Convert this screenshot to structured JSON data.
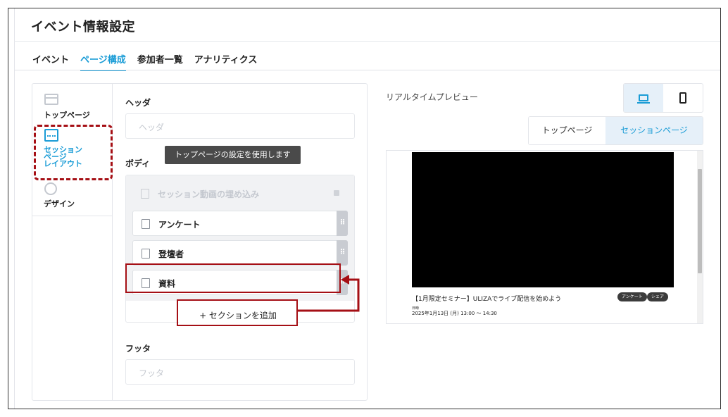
{
  "header": {
    "title": "イベント情報設定"
  },
  "tabs": [
    {
      "label": "イベント"
    },
    {
      "label": "ページ構成",
      "active": true
    },
    {
      "label": "参加者一覧"
    },
    {
      "label": "アナリティクス"
    }
  ],
  "sidebar": {
    "items": [
      {
        "label": "トップページ",
        "icon": "layout-icon"
      },
      {
        "label_lines": [
          "セッション",
          "ページ",
          "レイアウト"
        ],
        "icon": "session-layout-icon",
        "active": true
      },
      {
        "label": "デザイン",
        "icon": "palette-icon"
      }
    ]
  },
  "editor": {
    "header_label": "ヘッダ",
    "header_placeholder": "ヘッダ",
    "body_label": "ボディ",
    "tooltip": "トップページの設定を使用します",
    "rows": [
      {
        "label": "セッション動画の埋め込み",
        "disabled": true
      },
      {
        "label": "アンケート"
      },
      {
        "label": "登壇者"
      },
      {
        "label": "資料"
      }
    ],
    "add_section": "+ セクションを追加",
    "footer_label": "フッタ",
    "footer_placeholder": "フッタ"
  },
  "preview": {
    "label": "リアルタイムプレビュー",
    "page_buttons": [
      "トップページ",
      "セッションページ"
    ],
    "video_title": "【1月限定セミナー】ULIZAでライブ配信を始めよう",
    "pills": [
      "アンケート",
      "シェア"
    ],
    "date_label": "日時",
    "date": "2025年1月13日 (月) 13:00 ～ 14:30"
  },
  "colors": {
    "accent": "#1a9cd6",
    "annotation": "#a50f15"
  }
}
